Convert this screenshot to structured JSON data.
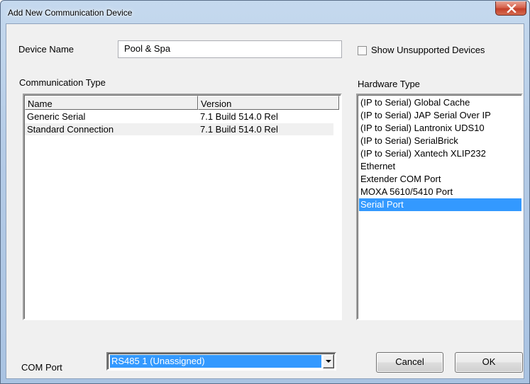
{
  "window": {
    "title": "Add New Communication Device"
  },
  "device_name": {
    "label": "Device Name",
    "value": "Pool & Spa"
  },
  "show_unsupported": {
    "label": "Show Unsupported Devices",
    "checked": false
  },
  "communication_type": {
    "label": "Communication Type",
    "columns": [
      "Name",
      "Version"
    ],
    "rows": [
      {
        "name": "Generic Serial",
        "version": "7.1 Build 514.0 Rel"
      },
      {
        "name": "Standard Connection",
        "version": "7.1 Build 514.0 Rel"
      }
    ]
  },
  "hardware_type": {
    "label": "Hardware Type",
    "items": [
      "(IP to Serial) Global Cache",
      "(IP to Serial) JAP Serial Over IP",
      "(IP to Serial) Lantronix UDS10",
      "(IP to Serial) SerialBrick",
      "(IP to Serial) Xantech XLIP232",
      "Ethernet",
      "Extender COM Port",
      "MOXA 5610/5410 Port",
      "Serial Port"
    ],
    "selected": "Serial Port"
  },
  "com_port": {
    "label": "COM Port",
    "value": "RS485 1 (Unassigned)"
  },
  "buttons": {
    "cancel": "Cancel",
    "ok": "OK"
  },
  "colors": {
    "selection": "#3399ff",
    "dialog_bg": "#f0f0f0",
    "close_button": "#c4402a"
  },
  "icons": {
    "close": "close-x-icon",
    "dropdown": "chevron-down-icon"
  }
}
